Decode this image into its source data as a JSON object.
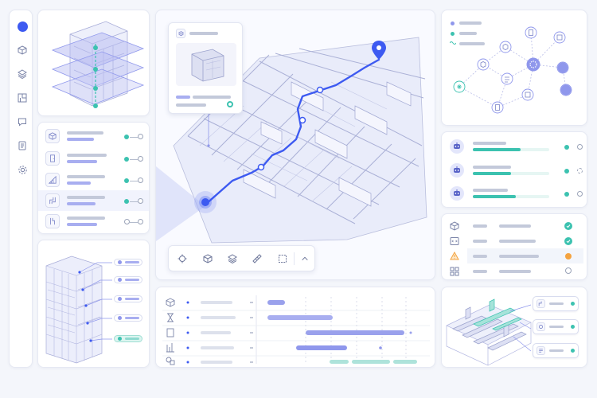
{
  "colors": {
    "accent": "#3d5af1",
    "purple": "#8f97ec",
    "teal": "#3cc2b0",
    "orange": "#f4a340",
    "border": "#e6e9f3"
  },
  "left_rail": {
    "items": [
      {
        "name": "home",
        "icon": "circle-dot-icon",
        "active": true
      },
      {
        "name": "model",
        "icon": "cube-icon"
      },
      {
        "name": "layers",
        "icon": "layers-icon"
      },
      {
        "name": "floorplan",
        "icon": "floorplan-icon"
      },
      {
        "name": "comments",
        "icon": "comment-icon"
      },
      {
        "name": "documents",
        "icon": "document-icon"
      },
      {
        "name": "settings",
        "icon": "gear-icon"
      }
    ]
  },
  "element_list": {
    "rows": [
      {
        "icon": "cube-icon",
        "state": "on"
      },
      {
        "icon": "door-icon",
        "state": "on"
      },
      {
        "icon": "stair-icon",
        "state": "on"
      },
      {
        "icon": "pipe-icon",
        "state": "on",
        "highlighted": true
      },
      {
        "icon": "duct-icon",
        "state": "off"
      }
    ]
  },
  "map_popup": {
    "icon": "layers-icon",
    "thumbnail": "cube-icon"
  },
  "map_toolbar": {
    "buttons": [
      {
        "name": "locate",
        "icon": "crosshair-icon"
      },
      {
        "name": "model",
        "icon": "cube-icon"
      },
      {
        "name": "layers",
        "icon": "layers-icon"
      },
      {
        "name": "measure",
        "icon": "ruler-icon"
      },
      {
        "name": "select",
        "icon": "select-frame-icon"
      },
      {
        "name": "collapse",
        "icon": "chevron-up-icon"
      }
    ]
  },
  "node_graph": {
    "legend": [
      {
        "icon": "dot-icon",
        "color": "#8f97ec"
      },
      {
        "icon": "dot-icon",
        "color": "#3cc2b0"
      },
      {
        "icon": "wave-icon",
        "color": "#3cc2b0"
      }
    ]
  },
  "assignee_list": {
    "rows": [
      {
        "icon": "robot-icon",
        "progress": 0.62,
        "status": "active"
      },
      {
        "icon": "robot-icon",
        "progress": 0.5,
        "status": "pending"
      },
      {
        "icon": "robot-icon",
        "progress": 0.56,
        "status": "active"
      }
    ]
  },
  "check_list": {
    "rows": [
      {
        "icon": "cube-icon",
        "status": "pass"
      },
      {
        "icon": "code-icon",
        "status": "pass"
      },
      {
        "icon": "warning-icon",
        "status": "warning"
      },
      {
        "icon": "grid-icon",
        "status": "none"
      }
    ]
  },
  "schedule": {
    "rows": [
      {
        "icon": "cube-icon"
      },
      {
        "icon": "hourglass-icon"
      },
      {
        "icon": "list-icon"
      },
      {
        "icon": "chart-icon"
      },
      {
        "icon": "shapes-icon"
      }
    ]
  },
  "mep_panel": {
    "cards": [
      {
        "icon": "pipe-icon"
      },
      {
        "icon": "camera-icon"
      },
      {
        "icon": "document-icon"
      }
    ]
  }
}
